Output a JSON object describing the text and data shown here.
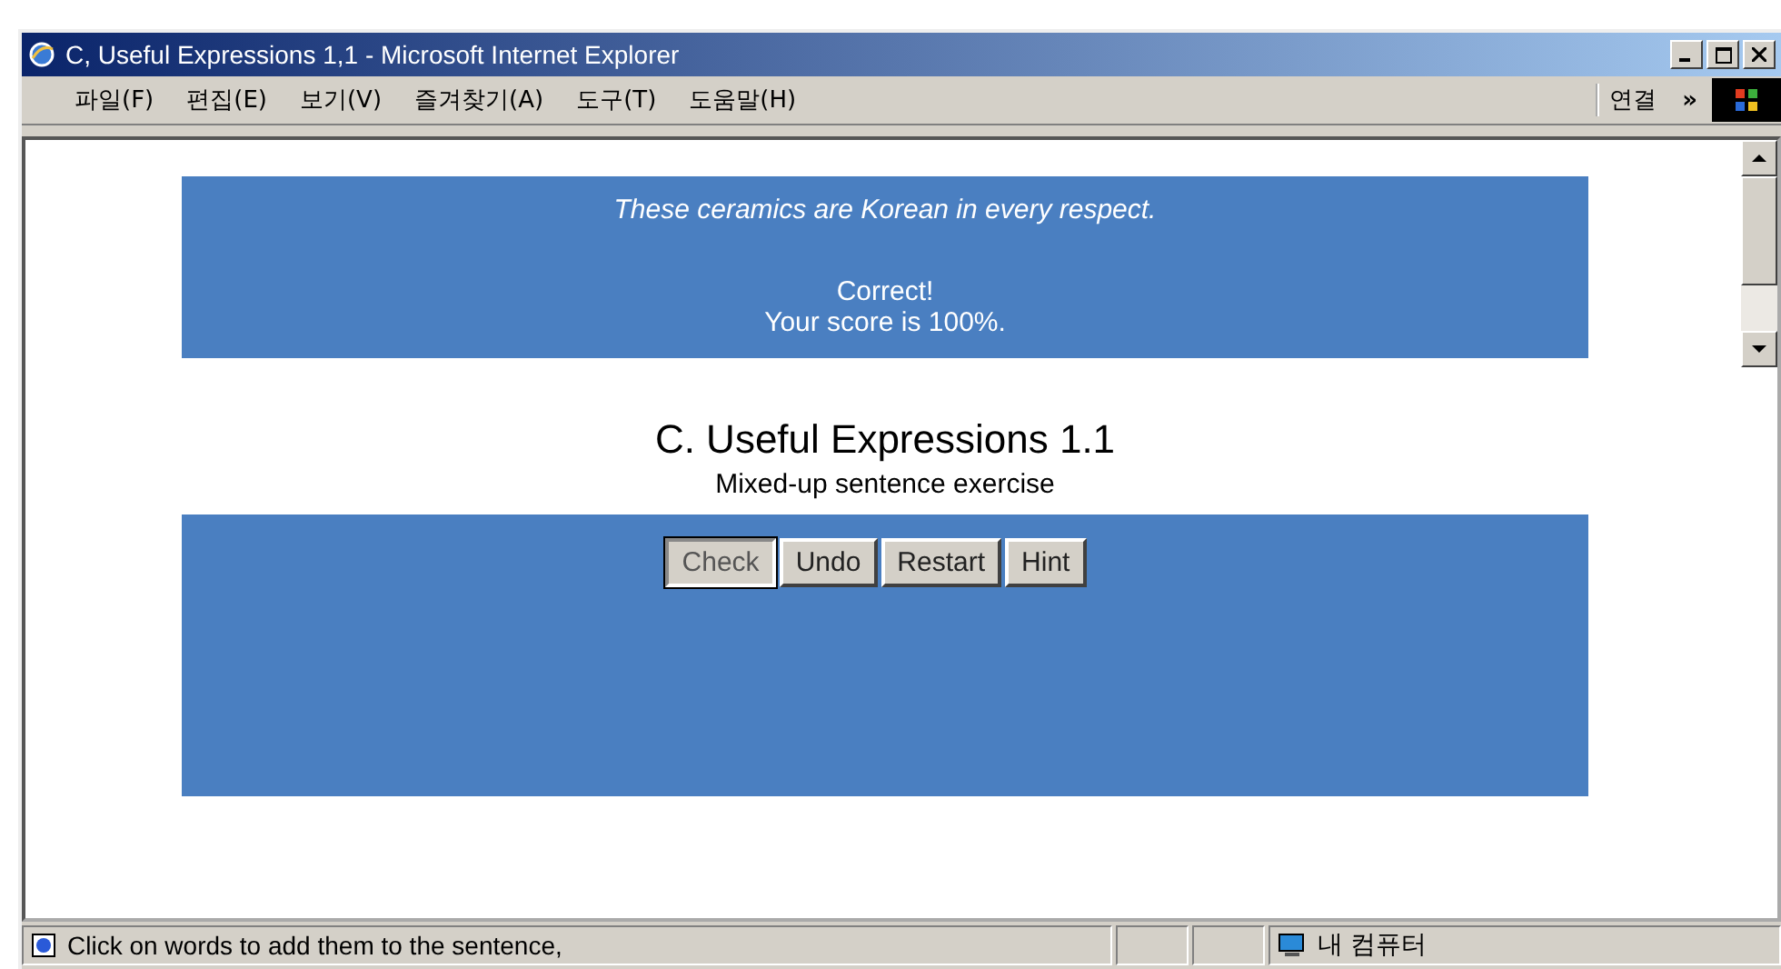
{
  "window": {
    "title": "C, Useful Expressions 1,1 - Microsoft Internet Explorer"
  },
  "menu": [
    {
      "label": "파일(F)"
    },
    {
      "label": "편집(E)"
    },
    {
      "label": "보기(V)"
    },
    {
      "label": "즐겨찾기(A)"
    },
    {
      "label": "도구(T)"
    },
    {
      "label": "도움말(H)"
    }
  ],
  "links_label": "연결",
  "chevron": "»",
  "feedback": {
    "sentence": "These ceramics are Korean in every respect.",
    "result": "Correct!",
    "score": "Your score is 100%."
  },
  "heading": "C. Useful Expressions 1.1",
  "subheading": "Mixed-up sentence exercise",
  "buttons": [
    {
      "label": "Check",
      "focused": true
    },
    {
      "label": "Undo",
      "focused": false
    },
    {
      "label": "Restart",
      "focused": false
    },
    {
      "label": "Hint",
      "focused": false
    }
  ],
  "status_bar": {
    "message": "Click on words to add them to the sentence,",
    "zone": "내 컴퓨터"
  }
}
